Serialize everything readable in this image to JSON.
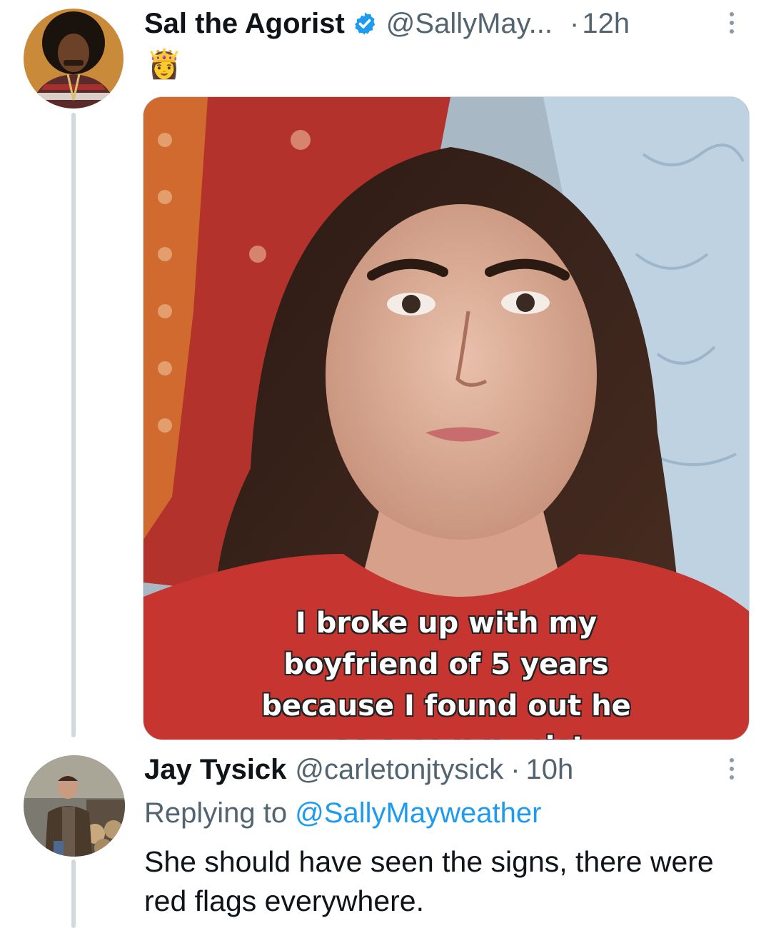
{
  "tweet1": {
    "display_name": "Sal the Agorist",
    "handle": "@SallyMay...",
    "separator": "·",
    "time": "12h",
    "bio_emoji": "👸",
    "avatar": "avatar-man-afro-icon",
    "image_caption": [
      "I broke up with my",
      "boyfriend of 5 years",
      "because I found out he",
      "was a communist"
    ]
  },
  "tweet2": {
    "display_name": "Jay Tysick",
    "handle": "@carletonjtysick",
    "separator": "·",
    "time": "10h",
    "avatar": "avatar-man-outdoors-icon",
    "replying_prefix": "Replying to",
    "replying_mention": "@SallyMayweather",
    "text": "She should have seen the signs, there were red flags everywhere."
  },
  "colors": {
    "verified_blue": "#1d9bf0",
    "thread_line": "#cfd9de",
    "secondary_text": "#536471",
    "primary_text": "#0f1419"
  },
  "icons": [
    "verified-badge-icon",
    "more-options-icon"
  ]
}
